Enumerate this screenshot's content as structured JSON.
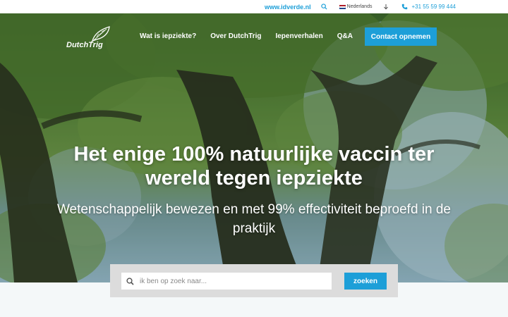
{
  "topbar": {
    "website": "www.idverde.nl",
    "language": "Nederlands",
    "phone": "+31 55 59 99 444",
    "icons": [
      "search-icon",
      "netherlands-flag-icon",
      "arrow-down-icon",
      "phone-icon"
    ],
    "flag_colors": [
      "#ae1c28",
      "#ffffff",
      "#21468b"
    ]
  },
  "header": {
    "logo_text": "DutchTrig",
    "nav": [
      {
        "label": "Wat is iepziekte?"
      },
      {
        "label": "Over DutchTrig"
      },
      {
        "label": "Iepenverhalen"
      },
      {
        "label": "Q&A"
      }
    ],
    "cta_label": "Contact opnemen"
  },
  "hero": {
    "headline": "Het enige 100% natuurlijke vaccin ter wereld tegen iepziekte",
    "subline": "Wetenschappelijk bewezen en met 99% effectiviteit beproefd in de praktijk"
  },
  "search": {
    "placeholder": "ik ben op zoek naar...",
    "value": "",
    "button_label": "zoeken"
  },
  "colors": {
    "accent": "#1d9fd8",
    "search_panel": "#dcdcdc",
    "page_bg": "#f4f8f9"
  }
}
